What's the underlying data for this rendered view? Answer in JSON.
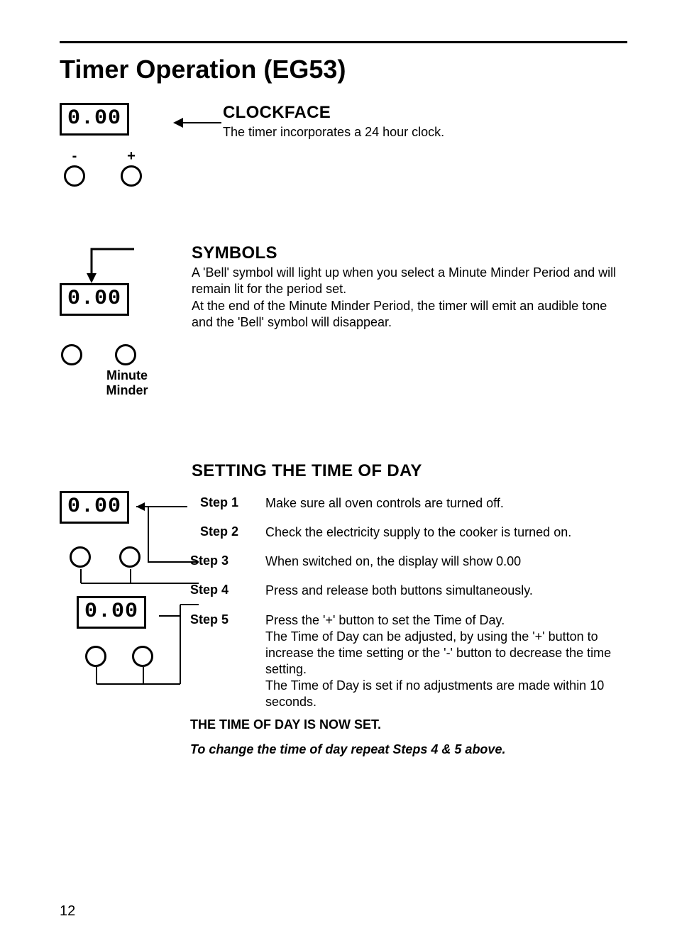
{
  "page_number": "12",
  "title": "Timer Operation (EG53)",
  "clockface": {
    "heading": "CLOCKFACE",
    "text": "The timer incorporates a 24 hour clock.",
    "display": "0.00",
    "minus_label": "-",
    "plus_label": "+"
  },
  "symbols": {
    "heading": "SYMBOLS",
    "text": "A 'Bell' symbol will light up when you select a Minute Minder Period and will remain lit for the period set.\nAt the end of the Minute Minder Period, the timer will emit an audible tone and the 'Bell' symbol will disappear.",
    "display": "0.00",
    "button_caption": "Minute\nMinder"
  },
  "setting_time": {
    "heading": "SETTING THE TIME OF DAY",
    "display_a": "0.00",
    "display_b": "0.00",
    "steps": [
      {
        "label": "Step 1",
        "text": "Make sure all oven controls are turned off."
      },
      {
        "label": "Step 2",
        "text": "Check the electricity supply to the cooker is turned on."
      },
      {
        "label": "Step 3",
        "text": "When switched on, the display will show 0.00"
      },
      {
        "label": "Step 4",
        "text": "Press and release both buttons simultaneously."
      },
      {
        "label": "Step 5",
        "text": "Press the '+' button to set the Time of Day.\nThe Time of Day can be adjusted, by using the '+' button to increase the time setting or the '-' button to decrease the time setting.\nThe Time of Day is set if no adjustments are made within 10 seconds."
      }
    ],
    "footnote_bold": "THE TIME OF DAY IS NOW SET.",
    "footnote_ital": "To change the time of day repeat Steps 4  & 5 above."
  }
}
